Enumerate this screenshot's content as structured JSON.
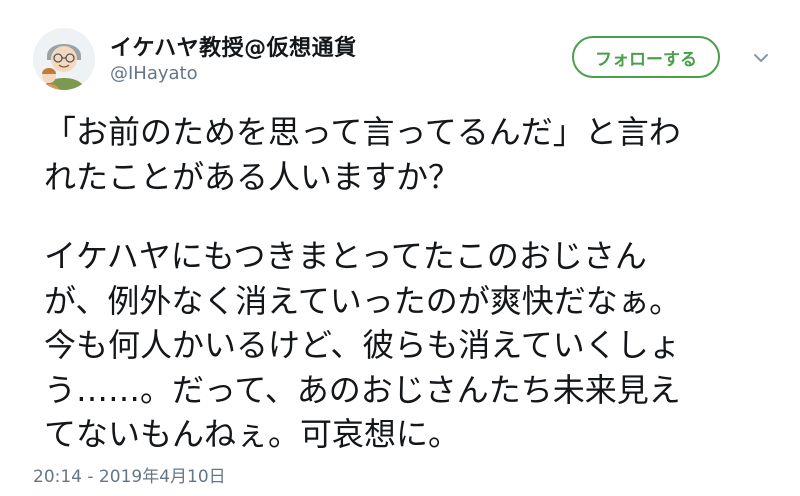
{
  "author": {
    "display_name": "イケハヤ教授@仮想通貨",
    "handle": "@IHayato"
  },
  "actions": {
    "follow_label": "フォローする",
    "menu_icon": "chevron-down-icon"
  },
  "tweet": {
    "lines": [
      "「お前のためを思って言ってるんだ」と言わ",
      "れたことがある人いますか？",
      "",
      "イケハヤにもつきまとってたこのおじさん",
      "が、例外なく消えていったのが爽快だなぁ。",
      "今も何人かいるけど、彼らも消えていくしょ",
      "う……。だって、あのおじさんたち未来見え",
      "てないもんねぇ。可哀想に。"
    ],
    "timestamp": "20:14 - 2019年4月10日"
  },
  "colors": {
    "follow_accent": "#4a9f4a",
    "muted_text": "#657786",
    "primary_text": "#14171a"
  }
}
